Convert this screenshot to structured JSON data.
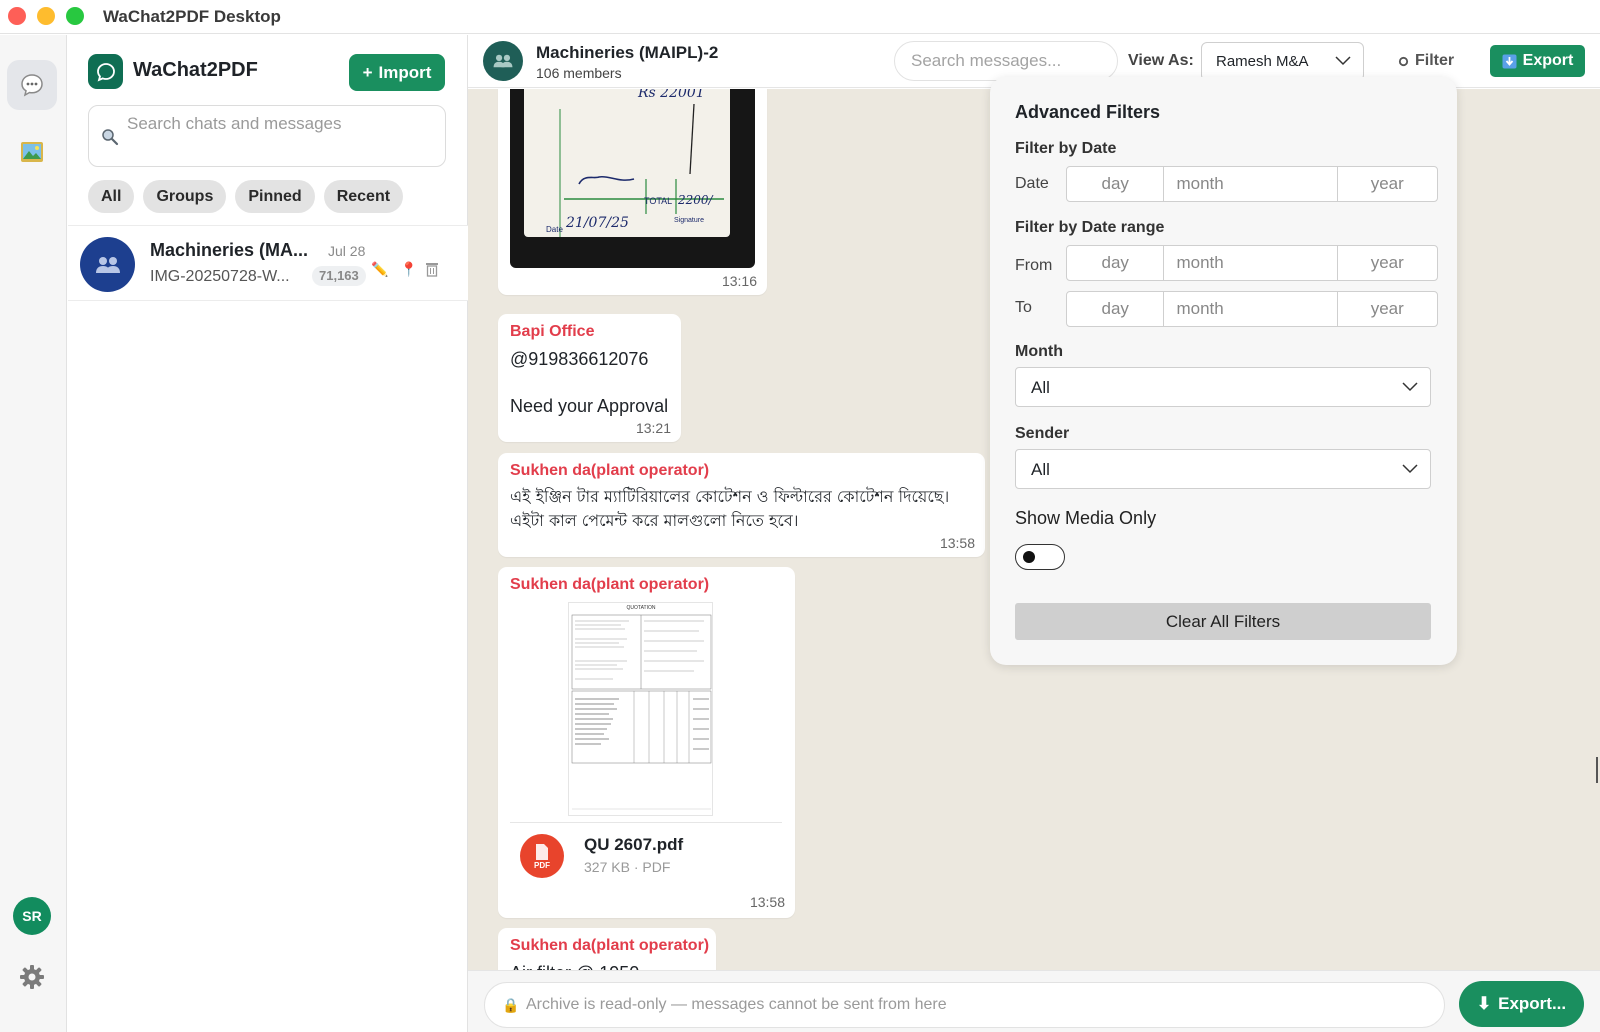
{
  "window": {
    "title": "WaChat2PDF Desktop"
  },
  "rail": {
    "avatar_initials": "SR"
  },
  "sidebar": {
    "brand": "WaChat2PDF",
    "import_label": "Import",
    "search_placeholder": "Search chats and messages",
    "filters": [
      "All",
      "Groups",
      "Pinned",
      "Recent"
    ],
    "chats": [
      {
        "name": "Machineries (MA...",
        "date": "Jul 28",
        "preview": "IMG-20250728-W...",
        "count": "71,163"
      }
    ]
  },
  "chat": {
    "title": "Machineries (MAIPL)-2",
    "members": "106 members",
    "search_placeholder": "Search messages...",
    "view_as_label": "View As:",
    "view_as_value": "Ramesh M&A",
    "filter_label": "Filter",
    "export_label": "Export"
  },
  "messages": [
    {
      "type": "image",
      "time": "13:16",
      "handwriting": {
        "top": "Rs 22001",
        "total_label": "TOTAL",
        "total": "2200/",
        "date_label": "Date",
        "date": "21/07/25",
        "signature_label": "Signature"
      }
    },
    {
      "type": "text",
      "sender": "Bapi Office",
      "lines": [
        "@919836612076",
        "",
        "Need your Approval"
      ],
      "time": "13:21"
    },
    {
      "type": "text",
      "sender": "Sukhen da(plant operator)",
      "lines": [
        "এই ইঞ্জিন টার ম্যাটিরিয়ালের  কোটেশন ও ফিল্টারের কোটেশন দিয়েছে।",
        "এইটা কাল পেমেন্ট করে মালগুলো নিতে হবে।"
      ],
      "time": "13:58"
    },
    {
      "type": "document",
      "sender": "Sukhen da(plant operator)",
      "file_name": "QU 2607.pdf",
      "file_meta": "327 KB · PDF",
      "file_badge": "PDF",
      "thumb_title": "QUOTATION",
      "time": "13:58"
    },
    {
      "type": "text",
      "sender": "Sukhen da(plant operator)",
      "lines": [
        "Air filter @ 1950"
      ]
    }
  ],
  "filter_panel": {
    "title": "Advanced Filters",
    "by_date_label": "Filter by Date",
    "date_row_label": "Date",
    "by_range_label": "Filter by Date range",
    "from_label": "From",
    "to_label": "To",
    "placeholders": {
      "day": "day",
      "month": "month",
      "year": "year"
    },
    "month_label": "Month",
    "month_value": "All",
    "sender_label": "Sender",
    "sender_value": "All",
    "media_only_label": "Show Media Only",
    "media_only": false,
    "clear_label": "Clear All Filters"
  },
  "footer": {
    "placeholder": "Archive is read-only — messages cannot be sent from here",
    "export_label": "Export..."
  },
  "colors": {
    "accent": "#1a8f5f",
    "sender": "#e23d4b",
    "chat_bg": "#ece8df"
  }
}
